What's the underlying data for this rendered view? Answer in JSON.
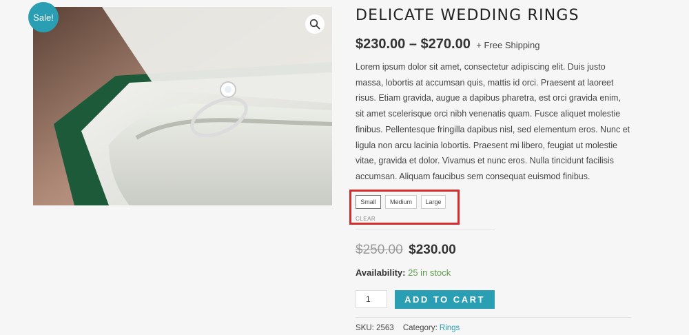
{
  "product": {
    "title": "DELICATE WEDDING RINGS",
    "sale_badge": "Sale!",
    "price_range": "$230.00 – $270.00",
    "shipping_note": "+ Free Shipping",
    "description": "Lorem ipsum dolor sit amet, consectetur adipiscing elit. Duis justo massa, lobortis at accumsan quis, mattis id orci. Praesent at laoreet risus. Etiam gravida, augue a dapibus pharetra, est orci gravida enim, sit amet scelerisque orci nibh venenatis quam. Fusce aliquet molestie finibus. Pellentesque fringilla dapibus nisl, sed elementum eros. Nunc et ligula non arcu lacinia lobortis. Praesent mi libero, feugiat ut molestie vitae, gravida et dolor. Vivamus et nunc eros. Nulla tincidunt facilisis accumsan. Aliquam faucibus sem consequat euismod finibus."
  },
  "variations": {
    "options": [
      "Small",
      "Medium",
      "Large"
    ],
    "selected": "Small",
    "clear_label": "CLEAR"
  },
  "variation_price": {
    "old": "$250.00",
    "new": "$230.00"
  },
  "availability": {
    "label": "Availability:",
    "value": "25 in stock"
  },
  "cart": {
    "quantity": "1",
    "button_label": "ADD TO CART"
  },
  "meta": {
    "sku_label": "SKU:",
    "sku_value": "2563",
    "category_label": "Category:",
    "category_value": "Rings"
  },
  "colors": {
    "accent": "#2a9eb3",
    "stock": "#5c9b4a",
    "highlight": "#d42b2b"
  },
  "icons": {
    "zoom": "magnifier-icon"
  }
}
